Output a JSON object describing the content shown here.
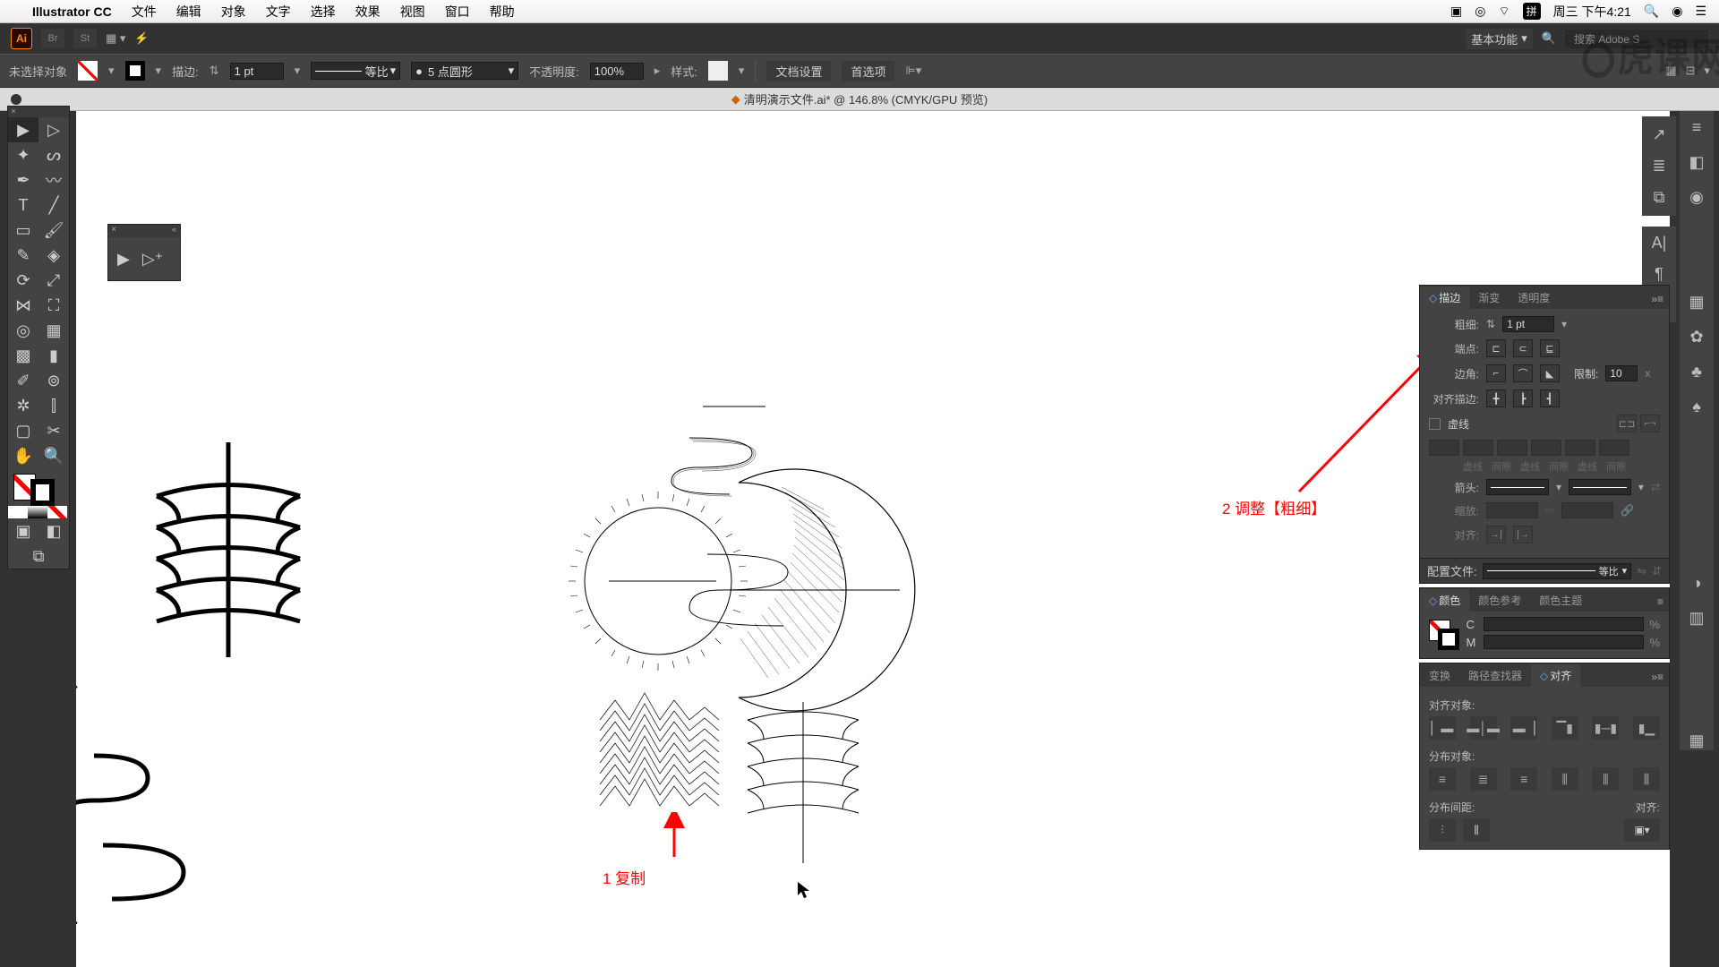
{
  "mac_menu": {
    "apple": "",
    "app": "Illustrator CC",
    "items": [
      "文件",
      "编辑",
      "对象",
      "文字",
      "选择",
      "效果",
      "视图",
      "窗口",
      "帮助"
    ],
    "right": {
      "ime": "拼",
      "day": "周三 下午4:21"
    }
  },
  "app_bar": {
    "workspace_label": "基本功能",
    "search_placeholder": "搜索 Adobe S"
  },
  "ctrl_bar": {
    "status": "未选择对象",
    "stroke_label": "描边:",
    "stroke_value": "1 pt",
    "style_label": "等比",
    "brush_label": "5 点圆形",
    "opacity_label": "不透明度:",
    "opacity_value": "100%",
    "style2_label": "样式:",
    "docset": "文档设置",
    "prefs": "首选项"
  },
  "doc": {
    "title": "清明演示文件.ai* @ 146.8% (CMYK/GPU 预览)"
  },
  "stroke_panel": {
    "tabs": [
      "描边",
      "渐变",
      "透明度"
    ],
    "weight_label": "粗细:",
    "weight_value": "1 pt",
    "cap_label": "端点:",
    "corner_label": "边角:",
    "limit_label": "限制:",
    "limit_value": "10",
    "align_label": "对齐描边:",
    "dash_label": "虚线",
    "dash_heads": [
      "虚线",
      "间隙",
      "虚线",
      "间隙",
      "虚线",
      "间隙"
    ],
    "arrow_label": "箭头:",
    "scale_label": "缩放:",
    "align2_label": "对齐:",
    "profile_label": "配置文件:",
    "profile_value": "等比"
  },
  "color_panel": {
    "tabs": [
      "颜色",
      "颜色参考",
      "颜色主题"
    ],
    "c": "C",
    "m": "M",
    "pct": "%"
  },
  "align_panel": {
    "tabs": [
      "变换",
      "路径查找器",
      "对齐"
    ],
    "align_obj": "对齐对象:",
    "dist_obj": "分布对象:",
    "dist_space": "分布间距:",
    "align_to": "对齐:"
  },
  "annotations": {
    "a1": "1 复制",
    "a2": "2 调整【粗细】"
  },
  "watermark": "虎课网"
}
